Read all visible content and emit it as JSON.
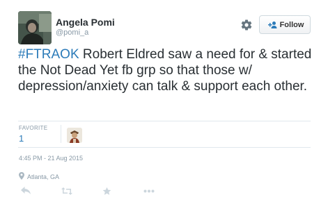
{
  "user": {
    "name": "Angela Pomi",
    "handle": "@pomi_a"
  },
  "follow_button": {
    "label": "Follow"
  },
  "tweet": {
    "hashtag": "#FTRAOK",
    "body": " Robert Eldred saw a need for & started the Not Dead Yet fb grp so that those w/ depression/anxiety can talk & support each other."
  },
  "stats": {
    "favorite_label": "FAVORITE",
    "favorite_count": "1"
  },
  "timestamp": "4:45 PM - 21 Aug 2015",
  "location": "Atlanta, GA",
  "icons": {
    "gear": "gear-icon",
    "follow": "add-person-icon",
    "location": "location-pin-icon",
    "reply": "reply-icon",
    "retweet": "retweet-icon",
    "favorite": "star-icon",
    "more": "more-icon"
  },
  "colors": {
    "link": "#2b7bb9",
    "muted": "#8899a6",
    "text": "#292f33",
    "action_icon": "#ccd6dd",
    "divider": "#e1e8ed"
  }
}
